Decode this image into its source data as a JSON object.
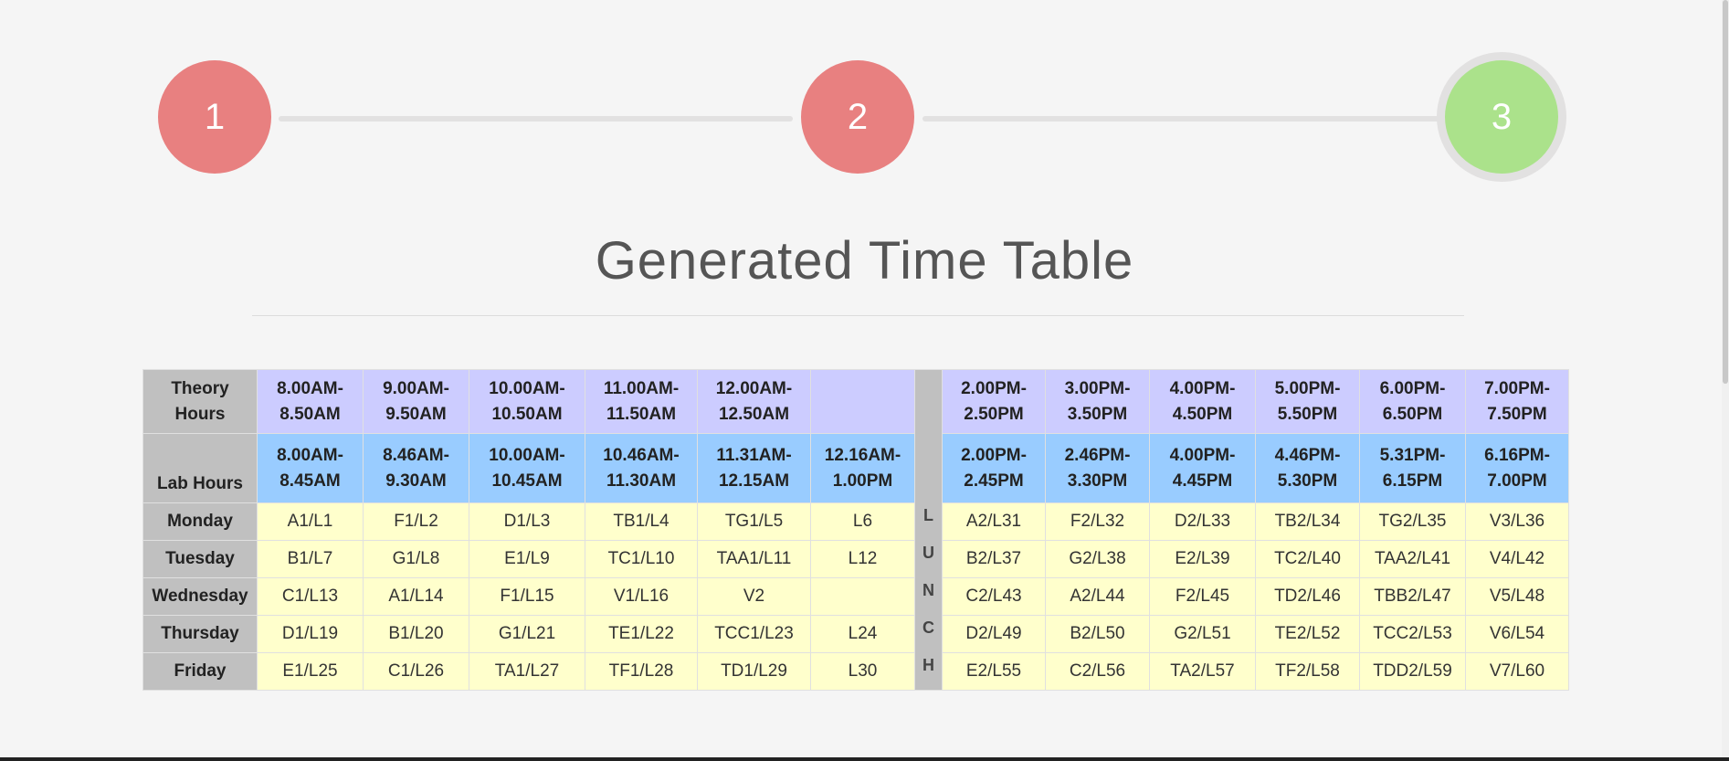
{
  "stepper": {
    "steps": [
      {
        "label": "1",
        "state": "done",
        "color": "#e88080"
      },
      {
        "label": "2",
        "state": "done",
        "color": "#e88080"
      },
      {
        "label": "3",
        "state": "active",
        "color": "#abe28b"
      }
    ]
  },
  "page_title": "Generated Time Table",
  "colors": {
    "header_gray": "#c0c0c0",
    "theory_row": "#ccccff",
    "lab_row": "#99ccff",
    "day_cells": "#ffffcc"
  },
  "timetable": {
    "theory_label": "Theory Hours",
    "lab_label": "Lab Hours",
    "theory_hours": [
      [
        "8.00AM-",
        "8.50AM"
      ],
      [
        "9.00AM-",
        "9.50AM"
      ],
      [
        "10.00AM-",
        "10.50AM"
      ],
      [
        "11.00AM-",
        "11.50AM"
      ],
      [
        "12.00AM-",
        "12.50AM"
      ],
      [
        "",
        ""
      ],
      [
        "2.00PM-",
        "2.50PM"
      ],
      [
        "3.00PM-",
        "3.50PM"
      ],
      [
        "4.00PM-",
        "4.50PM"
      ],
      [
        "5.00PM-",
        "5.50PM"
      ],
      [
        "6.00PM-",
        "6.50PM"
      ],
      [
        "7.00PM-",
        "7.50PM"
      ]
    ],
    "lab_hours": [
      [
        "8.00AM-",
        "8.45AM"
      ],
      [
        "8.46AM-",
        "9.30AM"
      ],
      [
        "10.00AM-",
        "10.45AM"
      ],
      [
        "10.46AM-",
        "11.30AM"
      ],
      [
        "11.31AM-",
        "12.15AM"
      ],
      [
        "12.16AM-",
        "1.00PM"
      ],
      [
        "2.00PM-",
        "2.45PM"
      ],
      [
        "2.46PM-",
        "3.30PM"
      ],
      [
        "4.00PM-",
        "4.45PM"
      ],
      [
        "4.46PM-",
        "5.30PM"
      ],
      [
        "5.31PM-",
        "6.15PM"
      ],
      [
        "6.16PM-",
        "7.00PM"
      ]
    ],
    "lunch_letters": [
      "L",
      "U",
      "N",
      "C",
      "H"
    ],
    "days": [
      {
        "day": "Monday",
        "slots": [
          "A1/L1",
          "F1/L2",
          "D1/L3",
          "TB1/L4",
          "TG1/L5",
          "L6",
          "A2/L31",
          "F2/L32",
          "D2/L33",
          "TB2/L34",
          "TG2/L35",
          "V3/L36"
        ]
      },
      {
        "day": "Tuesday",
        "slots": [
          "B1/L7",
          "G1/L8",
          "E1/L9",
          "TC1/L10",
          "TAA1/L11",
          "L12",
          "B2/L37",
          "G2/L38",
          "E2/L39",
          "TC2/L40",
          "TAA2/L41",
          "V4/L42"
        ]
      },
      {
        "day": "Wednesday",
        "slots": [
          "C1/L13",
          "A1/L14",
          "F1/L15",
          "V1/L16",
          "V2",
          "",
          "C2/L43",
          "A2/L44",
          "F2/L45",
          "TD2/L46",
          "TBB2/L47",
          "V5/L48"
        ]
      },
      {
        "day": "Thursday",
        "slots": [
          "D1/L19",
          "B1/L20",
          "G1/L21",
          "TE1/L22",
          "TCC1/L23",
          "L24",
          "D2/L49",
          "B2/L50",
          "G2/L51",
          "TE2/L52",
          "TCC2/L53",
          "V6/L54"
        ]
      },
      {
        "day": "Friday",
        "slots": [
          "E1/L25",
          "C1/L26",
          "TA1/L27",
          "TF1/L28",
          "TD1/L29",
          "L30",
          "E2/L55",
          "C2/L56",
          "TA2/L57",
          "TF2/L58",
          "TDD2/L59",
          "V7/L60"
        ]
      }
    ]
  }
}
